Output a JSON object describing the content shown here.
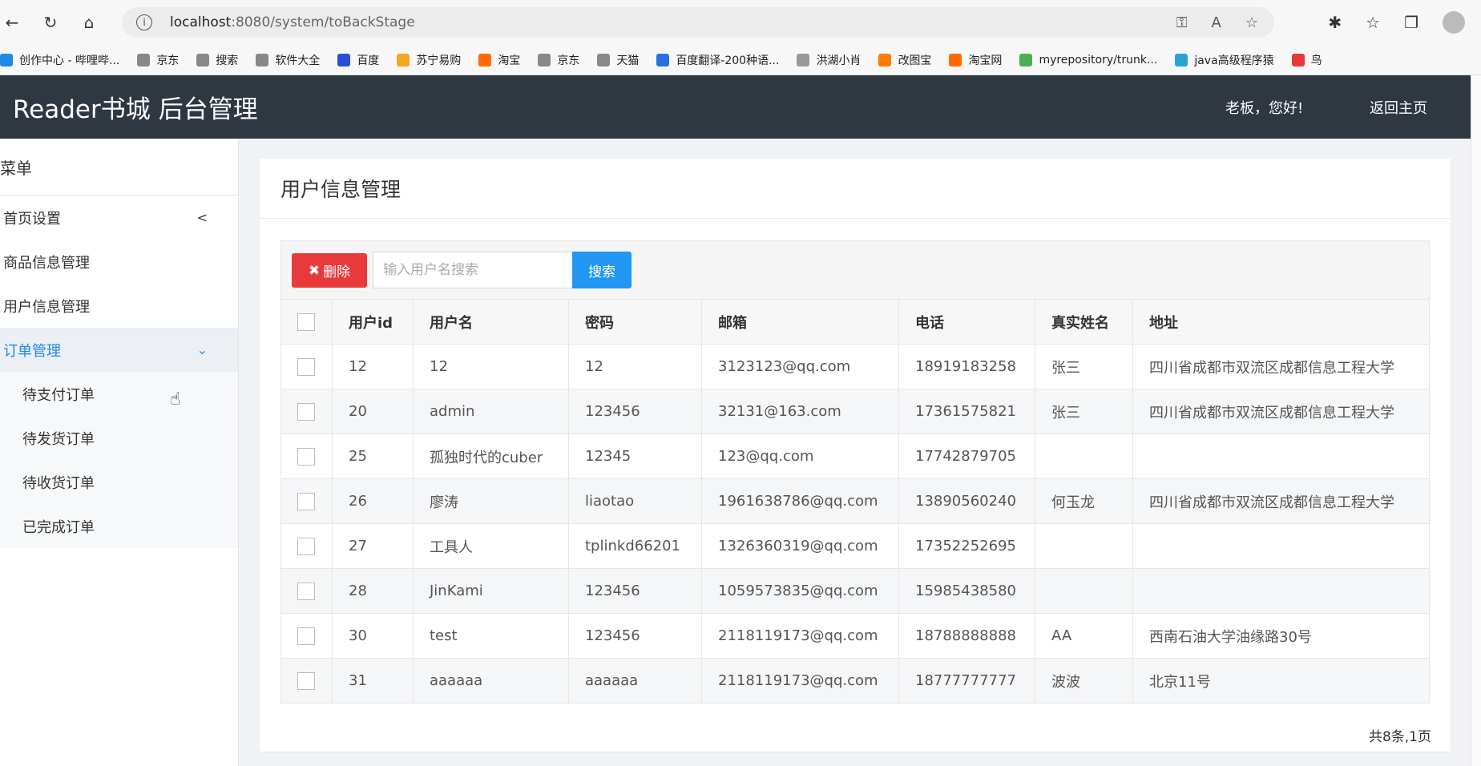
{
  "browser": {
    "url_host": "localhost",
    "url_path": ":8080/system/toBackStage",
    "bookmarks": [
      {
        "label": "创作中心 - 哔哩哔...",
        "color": "#1e88e5"
      },
      {
        "label": "京东",
        "color": "#888"
      },
      {
        "label": "搜索",
        "color": "#888"
      },
      {
        "label": "软件大全",
        "color": "#888"
      },
      {
        "label": "百度",
        "color": "#2a4fd6"
      },
      {
        "label": "苏宁易购",
        "color": "#f5a623"
      },
      {
        "label": "淘宝",
        "color": "#ff6a00"
      },
      {
        "label": "京东",
        "color": "#888"
      },
      {
        "label": "天猫",
        "color": "#888"
      },
      {
        "label": "百度翻译-200种语...",
        "color": "#2a6fe0"
      },
      {
        "label": "洪湖小肖",
        "color": "#999"
      },
      {
        "label": "改图宝",
        "color": "#ff7a00"
      },
      {
        "label": "淘宝网",
        "color": "#ff6a00"
      },
      {
        "label": "myrepository/trunk...",
        "color": "#4caf50"
      },
      {
        "label": "java高级程序猿",
        "color": "#29a3d6"
      },
      {
        "label": "鸟",
        "color": "#e53935"
      }
    ]
  },
  "header": {
    "title": "Reader书城 后台管理",
    "greeting": "老板，您好!",
    "back_home": "返回主页"
  },
  "sidebar": {
    "menu_title": "菜单",
    "items": [
      {
        "label": "首页设置"
      },
      {
        "label": "商品信息管理"
      },
      {
        "label": "用户信息管理"
      },
      {
        "label": "订单管理"
      }
    ],
    "sub_items": [
      {
        "label": "待支付订单"
      },
      {
        "label": "待发货订单"
      },
      {
        "label": "待收货订单"
      },
      {
        "label": "已完成订单"
      }
    ]
  },
  "panel": {
    "title": "用户信息管理",
    "delete_label": "删除",
    "search_placeholder": "输入用户名搜索",
    "search_label": "搜索",
    "pager": "共8条,1页"
  },
  "table": {
    "headers": [
      "用户id",
      "用户名",
      "密码",
      "邮箱",
      "电话",
      "真实姓名",
      "地址"
    ],
    "rows": [
      [
        "12",
        "12",
        "12",
        "3123123@qq.com",
        "18919183258",
        "张三",
        "四川省成都市双流区成都信息工程大学"
      ],
      [
        "20",
        "admin",
        "123456",
        "32131@163.com",
        "17361575821",
        "张三",
        "四川省成都市双流区成都信息工程大学"
      ],
      [
        "25",
        "孤独时代的cuber",
        "12345",
        "123@qq.com",
        "17742879705",
        "",
        ""
      ],
      [
        "26",
        "廖涛",
        "liaotao",
        "1961638786@qq.com",
        "13890560240",
        "何玉龙",
        "四川省成都市双流区成都信息工程大学"
      ],
      [
        "27",
        "工具人",
        "tplinkd66201",
        "1326360319@qq.com",
        "17352252695",
        "",
        ""
      ],
      [
        "28",
        "JinKami",
        "123456",
        "1059573835@qq.com",
        "15985438580",
        "",
        ""
      ],
      [
        "30",
        "test",
        "123456",
        "2118119173@qq.com",
        "18788888888",
        "AA",
        "西南石油大学油缘路30号"
      ],
      [
        "31",
        "aaaaaa",
        "aaaaaa",
        "2118119173@qq.com",
        "18777777777",
        "波波",
        "北京11号"
      ]
    ]
  }
}
